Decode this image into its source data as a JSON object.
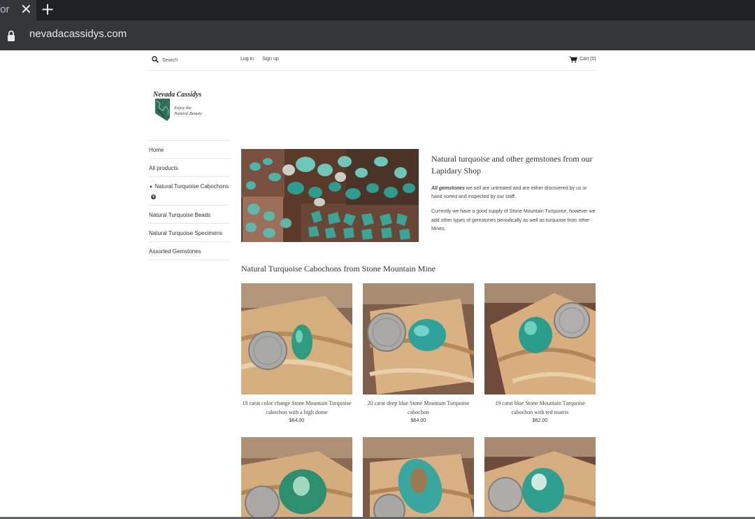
{
  "browser": {
    "tab_title": "for",
    "url": "nevadacassidys.com"
  },
  "header": {
    "search_placeholder": "Search",
    "login": "Log in",
    "signup": "Sign up",
    "cart": "Cart (0)"
  },
  "logo": {
    "brand": "Nevada Cassidys",
    "tagline_1": "Enjoy the",
    "tagline_2": "Natural Beauty"
  },
  "nav": {
    "items": [
      {
        "label": "Home"
      },
      {
        "label": "All products"
      },
      {
        "label": "Natural Turquoise Cabochons"
      },
      {
        "label": "Natural Turquoise Beads"
      },
      {
        "label": "Natural Turquoise Specimens"
      },
      {
        "label": "Assorted Gemstones"
      }
    ]
  },
  "hero": {
    "title": "Natural turquoise and other gemstones from our Lapidary Shop",
    "p1_bold": "All gemstones",
    "p1_rest": " we sell are untreated and are either discovered by us or hand sorted and inspected by our staff.",
    "p2": "Currently we have a good supply of Stone Mountain Turquoise, however we add other types of gemstones periodically as well as turquoise from other Mines."
  },
  "section": {
    "title": "Natural Turquoise Cabochons from Stone Mountain Mine"
  },
  "products": [
    {
      "title": "18 carat color change Stone Mountain Turquoise cabochon with a high dome",
      "price": "$64.00"
    },
    {
      "title": "20 carat deep blue Stone Mountain Turquoise cabochon",
      "price": "$64.00"
    },
    {
      "title": "19 carat blue Stone Mountain Turquoise cabochon with red matrix",
      "price": "$62.00"
    }
  ],
  "colors": {
    "chrome_dark": "#202124",
    "chrome_bar": "#35363a",
    "turquoise": "#2ea89a",
    "sandstone": "#c89a63"
  }
}
